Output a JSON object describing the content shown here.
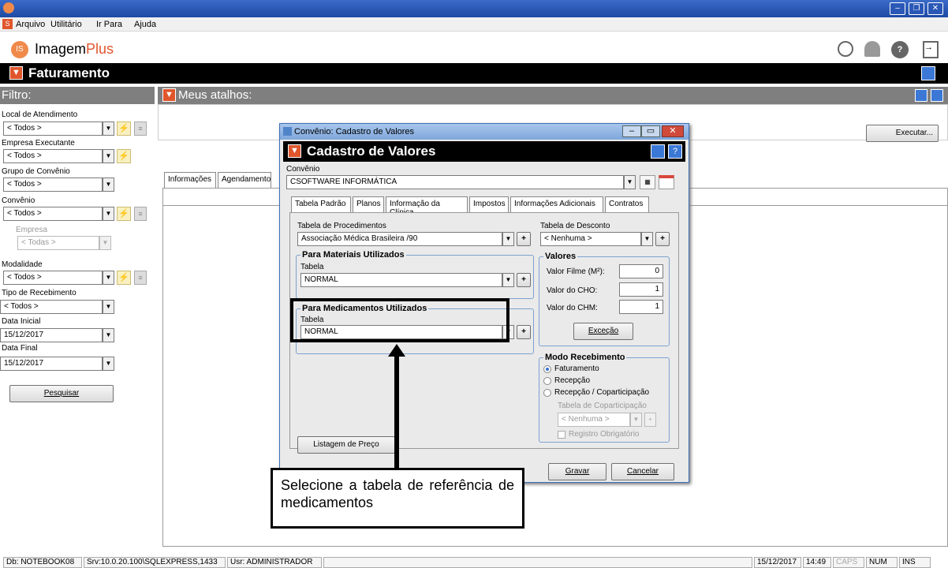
{
  "menu": {
    "items": [
      "Arquivo",
      "Utilitário",
      "Ir Para",
      "Ajuda"
    ]
  },
  "brand": {
    "logo_text": "Imagem",
    "logo_accent": "Plus"
  },
  "module": {
    "title": "Faturamento"
  },
  "filter": {
    "header": "Filtro:",
    "local_label": "Local de Atendimento",
    "local_value": "< Todos >",
    "empresa_label": "Empresa Executante",
    "empresa_value": "< Todos >",
    "grupo_label": "Grupo de Convênio",
    "grupo_value": "< Todos >",
    "convenio_label": "Convênio",
    "convenio_value": "< Todos >",
    "sub_empresa_label": "Empresa",
    "sub_empresa_value": "< Todas >",
    "modalidade_label": "Modalidade",
    "modalidade_value": "< Todos >",
    "tipo_label": "Tipo de Recebimento",
    "tipo_value": "< Todos >",
    "data_inicial_label": "Data Inicial",
    "data_inicial_value": "15/12/2017",
    "data_final_label": "Data Final",
    "data_final_value": "15/12/2017",
    "pesquisar": "Pesquisar"
  },
  "main": {
    "atalhos_header": "Meus atalhos:",
    "executar": "Executar...",
    "tabs": [
      "Informações",
      "Agendamento"
    ]
  },
  "dialog": {
    "window_title": "Convênio: Cadastro de Valores",
    "header": "Cadastro de Valores",
    "convenio_label": "Convênio",
    "convenio_value": "CSOFTWARE INFORMÁTICA",
    "tabs": [
      "Tabela Padrão",
      "Planos",
      "Informação da Clínica",
      "Impostos",
      "Informações Adicionais",
      "Contratos"
    ],
    "tab_proc_label": "Tabela de Procedimentos",
    "tab_proc_value": "Associação Médica Brasileira /90",
    "tab_desc_label": "Tabela de Desconto",
    "tab_desc_value": "< Nenhuma >",
    "mat_title": "Para Materiais Utilizados",
    "mat_tabela_label": "Tabela",
    "mat_value": "NORMAL",
    "med_title": "Para Medicamentos Utilizados",
    "med_tabela_label": "Tabela",
    "med_value": "NORMAL",
    "valores_title": "Valores",
    "filme_label": "Valor Filme (M²):",
    "filme_value": "0",
    "cho_label": "Valor do CHO:",
    "cho_value": "1",
    "chm_label": "Valor do CHM:",
    "chm_value": "1",
    "excecao": "Exceção",
    "modo_title": "Modo Recebimento",
    "radio_faturamento": "Faturamento",
    "radio_recepcao": "Recepção",
    "radio_recep_copart": "Recepção / Coparticipação",
    "copart_label": "Tabela de Coparticipação",
    "copart_value": "< Nenhuma >",
    "registro": "Registro Obrigatório",
    "listagem": "Listagem de Preço",
    "gravar": "Gravar",
    "cancelar": "Cancelar"
  },
  "callout": {
    "text": "Selecione a tabela de referência de medicamentos"
  },
  "status": {
    "db": "Db: NOTEBOOK08",
    "srv": "Srv:10.0.20.100\\SQLEXPRESS,1433",
    "usr": "Usr: ADMINISTRADOR",
    "date": "15/12/2017",
    "time": "14:49",
    "caps": "CAPS",
    "num": "NUM",
    "ins": "INS"
  },
  "colors": {
    "accent": "#e0562c",
    "titlebar": "#1d4aa4",
    "callout_border": "#000000"
  }
}
